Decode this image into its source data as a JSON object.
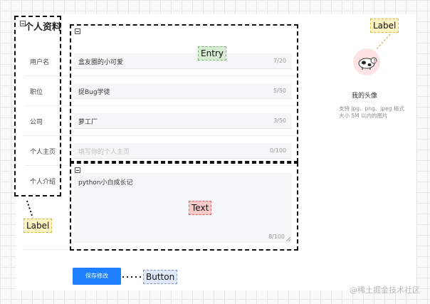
{
  "form": {
    "title": "个人资料",
    "labels": [
      "用户名",
      "职位",
      "公司",
      "个人主页",
      "个人介绍"
    ],
    "fields": [
      {
        "value": "盒友圈的小可爱",
        "placeholder": "",
        "count": "7/20"
      },
      {
        "value": "捉Bug学徒",
        "placeholder": "",
        "count": "5/50"
      },
      {
        "value": "萝工厂",
        "placeholder": "",
        "count": "3/50"
      },
      {
        "value": "",
        "placeholder": "填写你的个人主页",
        "count": "0/100"
      }
    ],
    "intro": {
      "value": "python小白成长记",
      "count": "8/100"
    },
    "save_label": "保存修改"
  },
  "avatar": {
    "title": "我的头像",
    "description": "支持 jpg、png、jpeg 格式大小 5M 以内的图片"
  },
  "annotations": {
    "entry": "Entry",
    "text": "Text",
    "label_left": "Label",
    "label_right": "Label",
    "button": "Button"
  },
  "watermark": "@稀土掘金技术社区",
  "colors": {
    "primary": "#1e80ff",
    "entry_tag": "#d6ecd2",
    "text_tag": "#f8c9c9",
    "label_tag": "#fdf2c2",
    "button_tag": "#dfe8f8"
  }
}
